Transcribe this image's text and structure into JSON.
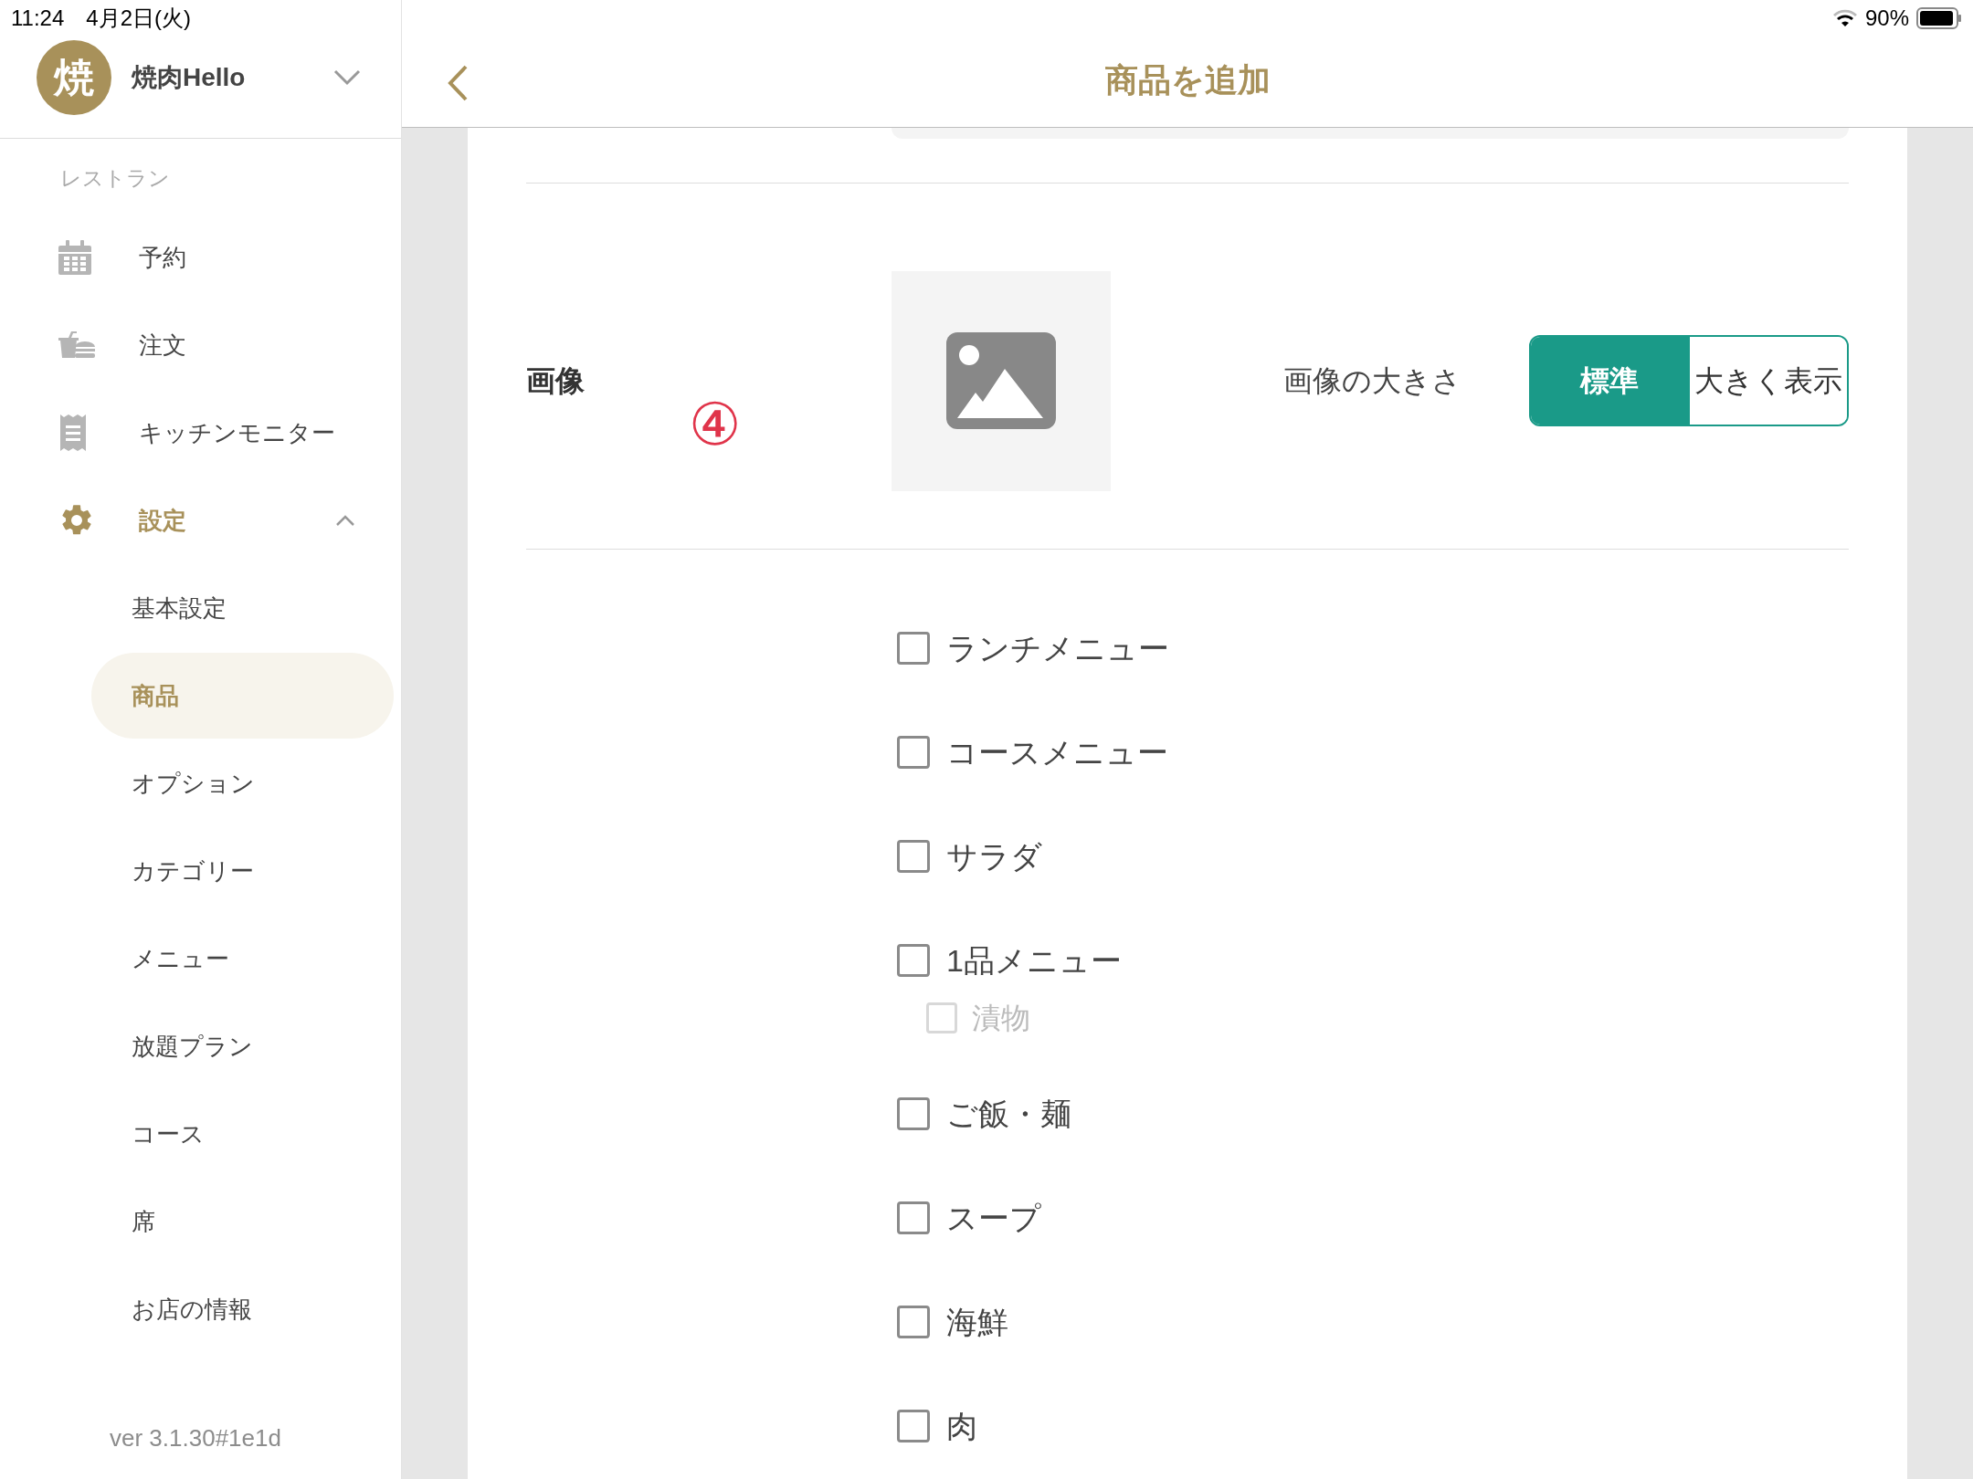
{
  "status_bar": {
    "time_date": "11:24　4月2日(火)",
    "battery": "90%"
  },
  "sidebar": {
    "account": {
      "avatar": "焼",
      "name": "焼肉Hello"
    },
    "section": "レストラン",
    "items": [
      {
        "label": "予約",
        "selected": false
      },
      {
        "label": "注文",
        "selected": false
      },
      {
        "label": "キッチンモニター",
        "selected": false
      },
      {
        "label": "設定",
        "selected": true,
        "expanded": true,
        "children": [
          {
            "label": "基本設定",
            "selected": false
          },
          {
            "label": "商品",
            "selected": true
          },
          {
            "label": "オプション",
            "selected": false
          },
          {
            "label": "カテゴリー",
            "selected": false
          },
          {
            "label": "メニュー",
            "selected": false
          },
          {
            "label": "放題プラン",
            "selected": false
          },
          {
            "label": "コース",
            "selected": false
          },
          {
            "label": "席",
            "selected": false
          },
          {
            "label": "お店の情報",
            "selected": false
          }
        ]
      }
    ],
    "version": "ver 3.1.30#1e1d"
  },
  "header": {
    "title": "商品を追加"
  },
  "form": {
    "image": {
      "label": "画像",
      "annotation": "④",
      "size_label": "画像の大きさ",
      "size_options": [
        {
          "label": "標準",
          "selected": true
        },
        {
          "label": "大きく表示",
          "selected": false
        }
      ]
    },
    "categories": [
      {
        "label": "ランチメニュー",
        "checked": false
      },
      {
        "label": "コースメニュー",
        "checked": false
      },
      {
        "label": "サラダ",
        "checked": false
      },
      {
        "label": "1品メニュー",
        "checked": false,
        "children": [
          {
            "label": "漬物",
            "checked": false,
            "disabled": true
          }
        ]
      },
      {
        "label": "ご飯・麺",
        "checked": false
      },
      {
        "label": "スープ",
        "checked": false
      },
      {
        "label": "海鮮",
        "checked": false
      },
      {
        "label": "肉",
        "checked": false
      }
    ]
  }
}
